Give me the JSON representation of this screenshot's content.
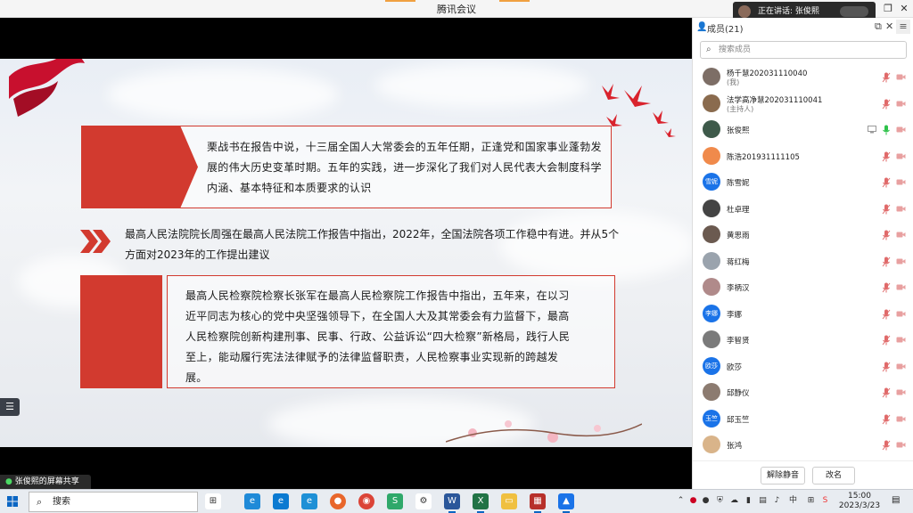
{
  "window": {
    "title": "腾讯会议"
  },
  "speaking": {
    "text": "正在讲话: 张俊熙"
  },
  "slide": {
    "box1_text": "栗战书在报告中说，十三届全国人大常委会的五年任期，正逢党和国家事业蓬勃发展的伟大历史变革时期。五年的实践，进一步深化了我们对人民代表大会制度科学内涵、基本特征和本质要求的认识",
    "mid_text": "最高人民法院院长周强在最高人民法院工作报告中指出，2022年，全国法院各项工作稳中有进。并从5个方面对2023年的工作提出建议",
    "box3_text": "最高人民检察院检察长张军在最高人民检察院工作报告中指出，五年来，在以习近平同志为核心的党中央坚强领导下，在全国人大及其常委会有力监督下，最高人民检察院创新构建刑事、民事、行政、公益诉讼“四大检察”新格局，践行人民至上，能动履行宪法法律赋予的法律监督职责，人民检察事业实现新的跨越发展。"
  },
  "share_label": "张俊熙的屏幕共享",
  "panel": {
    "title": "成员(21)",
    "search_placeholder": "搜索成员",
    "members": [
      {
        "name": "杨千慧202031110040",
        "role": "(我)",
        "avatar_text": "",
        "avatar_color": "#7d6e66",
        "share": false,
        "mic_on": false
      },
      {
        "name": "法学高净慧202031110041",
        "role": "(主持人)",
        "avatar_text": "",
        "avatar_color": "#8a6b4e",
        "share": false,
        "mic_on": false
      },
      {
        "name": "张俊熙",
        "role": "",
        "avatar_text": "",
        "avatar_color": "#3e5a4a",
        "share": true,
        "mic_on": true
      },
      {
        "name": "陈浩201931111105",
        "role": "",
        "avatar_text": "",
        "avatar_color": "#f08a4b",
        "share": false,
        "mic_on": false
      },
      {
        "name": "陈雪妮",
        "role": "",
        "avatar_text": "雪妮",
        "avatar_color": "#1a73e8",
        "share": false,
        "mic_on": false
      },
      {
        "name": "杜卓理",
        "role": "",
        "avatar_text": "",
        "avatar_color": "#444444",
        "share": false,
        "mic_on": false
      },
      {
        "name": "黄思雨",
        "role": "",
        "avatar_text": "",
        "avatar_color": "#6b5a50",
        "share": false,
        "mic_on": false
      },
      {
        "name": "蒋红梅",
        "role": "",
        "avatar_text": "",
        "avatar_color": "#9aa3ad",
        "share": false,
        "mic_on": false
      },
      {
        "name": "李柄汉",
        "role": "",
        "avatar_text": "",
        "avatar_color": "#b08a8a",
        "share": false,
        "mic_on": false
      },
      {
        "name": "李娜",
        "role": "",
        "avatar_text": "李娜",
        "avatar_color": "#1a73e8",
        "share": false,
        "mic_on": false
      },
      {
        "name": "李智贤",
        "role": "",
        "avatar_text": "",
        "avatar_color": "#7a7a7a",
        "share": false,
        "mic_on": false
      },
      {
        "name": "欧莎",
        "role": "",
        "avatar_text": "欧莎",
        "avatar_color": "#1a73e8",
        "share": false,
        "mic_on": false
      },
      {
        "name": "邱静仪",
        "role": "",
        "avatar_text": "",
        "avatar_color": "#8c7b70",
        "share": false,
        "mic_on": false
      },
      {
        "name": "邱玉竺",
        "role": "",
        "avatar_text": "玉竺",
        "avatar_color": "#1a73e8",
        "share": false,
        "mic_on": false
      },
      {
        "name": "张鸿",
        "role": "",
        "avatar_text": "",
        "avatar_color": "#d9b48a",
        "share": false,
        "mic_on": false
      }
    ],
    "unmute_all": "解除静音",
    "rename": "改名"
  },
  "taskbar": {
    "search": "搜索",
    "time": "15:00",
    "date": "2023/3/23",
    "colors": {
      "accent": "#0b66c3"
    }
  }
}
